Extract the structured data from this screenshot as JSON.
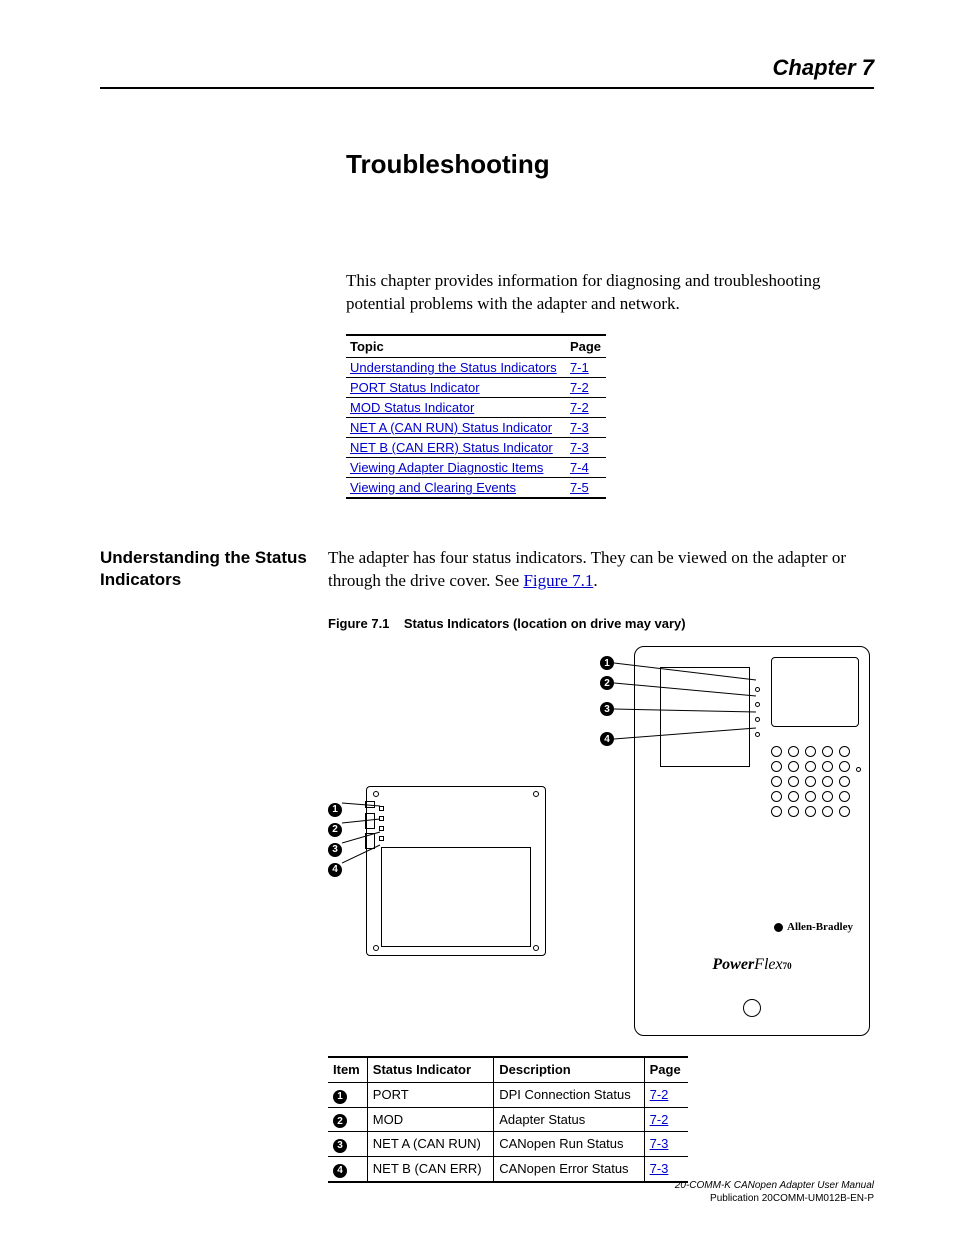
{
  "header": {
    "chapter": "Chapter 7"
  },
  "title": "Troubleshooting",
  "intro": "This chapter provides information for diagnosing and troubleshooting potential problems with the adapter and network.",
  "toc": {
    "headers": {
      "topic": "Topic",
      "page": "Page"
    },
    "rows": [
      {
        "topic": "Understanding the Status Indicators",
        "page": "7-1"
      },
      {
        "topic": "PORT Status Indicator",
        "page": "7-2"
      },
      {
        "topic": "MOD Status Indicator",
        "page": "7-2"
      },
      {
        "topic": "NET A (CAN RUN) Status Indicator",
        "page": "7-3"
      },
      {
        "topic": "NET B (CAN ERR) Status Indicator",
        "page": "7-3"
      },
      {
        "topic": "Viewing Adapter Diagnostic Items",
        "page": "7-4"
      },
      {
        "topic": "Viewing and Clearing Events",
        "page": "7-5"
      }
    ]
  },
  "section1": {
    "heading": "Understanding the Status Indicators",
    "body_pre": "The adapter has four status indicators. They can be viewed on the adapter or through the drive cover. See ",
    "fig_link": "Figure 7.1",
    "body_post": ".",
    "fig_caption_label": "Figure 7.1",
    "fig_caption_text": "Status Indicators (location on drive may vary)"
  },
  "drive_brand": {
    "brand1": "Allen-Bradley",
    "brand2_main": "Power",
    "brand2_italic": "Flex",
    "brand2_sub": "70"
  },
  "callouts": {
    "c1": "1",
    "c2": "2",
    "c3": "3",
    "c4": "4"
  },
  "item_table": {
    "headers": {
      "item": "Item",
      "indicator": "Status Indicator",
      "desc": "Description",
      "page": "Page"
    },
    "rows": [
      {
        "num": "1",
        "indicator": "PORT",
        "desc": "DPI Connection Status",
        "page": "7-2"
      },
      {
        "num": "2",
        "indicator": "MOD",
        "desc": "Adapter Status",
        "page": "7-2"
      },
      {
        "num": "3",
        "indicator": "NET A (CAN RUN)",
        "desc": "CANopen Run Status",
        "page": "7-3"
      },
      {
        "num": "4",
        "indicator": "NET B (CAN ERR)",
        "desc": "CANopen Error Status",
        "page": "7-3"
      }
    ]
  },
  "footer": {
    "line1": "20-COMM-K CANopen Adapter User Manual",
    "line2": "Publication 20COMM-UM012B-EN-P"
  }
}
